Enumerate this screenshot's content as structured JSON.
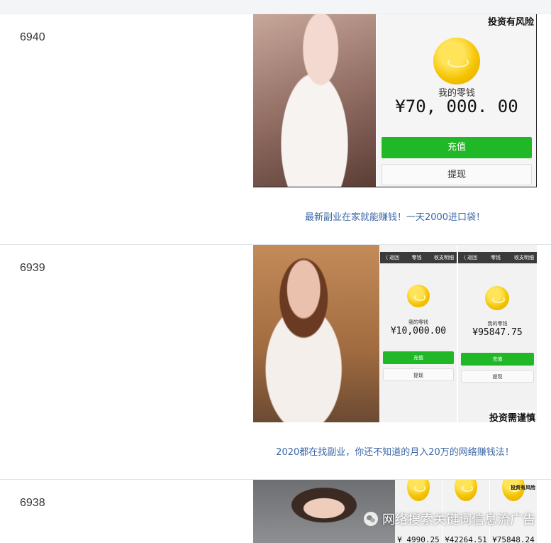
{
  "rows": [
    {
      "id": "6940",
      "title": "最新副业在家就能赚钱！一天2000进口袋！",
      "wallet": {
        "risk_tag": "投资有风险",
        "label": "我的零钱",
        "amount": "¥70, 000. 00",
        "recharge": "充值",
        "withdraw": "提现"
      }
    },
    {
      "id": "6939",
      "title": "2020都在找副业，你还不知道的月入20万的网络赚钱法！",
      "wallets": [
        {
          "back": "〈 返回",
          "head": "零钱",
          "ledger": "收支明细",
          "label": "我的零钱",
          "amount": "¥10,000.00",
          "recharge": "充值",
          "withdraw": "提现"
        },
        {
          "back": "〈 返回",
          "head": "零钱",
          "ledger": "收支明细",
          "label": "我的零钱",
          "amount": "¥95847.75",
          "recharge": "充值",
          "withdraw": "提现"
        }
      ],
      "risk_tag": "投资需谨慎"
    },
    {
      "id": "6938",
      "wallet_amounts": [
        "¥ 4990.25",
        "¥42264.51",
        "¥75848.24"
      ],
      "risk_tag": "投资有风险"
    }
  ],
  "watermark": "网络搜索关键词信息流广告",
  "colors": {
    "link": "#3b67a5",
    "green_button": "#21b827",
    "coin": "#f4c300"
  }
}
